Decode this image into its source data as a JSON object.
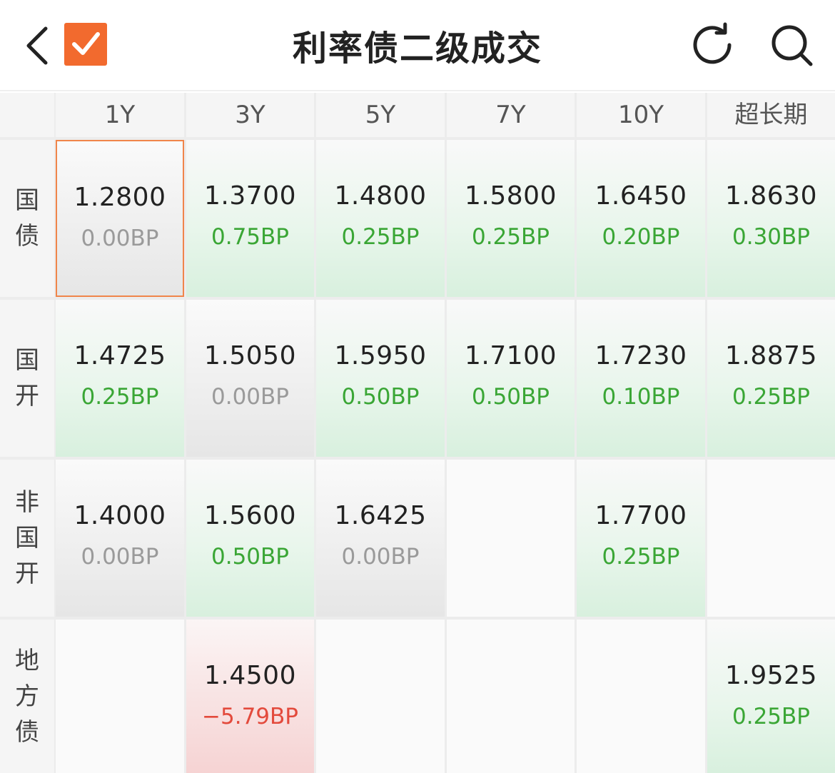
{
  "header": {
    "title": "利率债二级成交",
    "icons": {
      "back": "back-chevron-icon",
      "logo": "checkbox-logo-icon",
      "refresh": "refresh-icon",
      "search": "search-icon"
    },
    "accent_color": "#f26a2e"
  },
  "table": {
    "columns": [
      "1Y",
      "3Y",
      "5Y",
      "7Y",
      "10Y",
      "超长期"
    ],
    "rows": [
      {
        "label": [
          "国",
          "债"
        ],
        "cells": [
          {
            "value": "1.2800",
            "change": "0.00BP",
            "trend": "neutral",
            "selected": true
          },
          {
            "value": "1.3700",
            "change": "0.75BP",
            "trend": "up"
          },
          {
            "value": "1.4800",
            "change": "0.25BP",
            "trend": "up"
          },
          {
            "value": "1.5800",
            "change": "0.25BP",
            "trend": "up"
          },
          {
            "value": "1.6450",
            "change": "0.20BP",
            "trend": "up"
          },
          {
            "value": "1.8630",
            "change": "0.30BP",
            "trend": "up"
          }
        ]
      },
      {
        "label": [
          "国",
          "开"
        ],
        "cells": [
          {
            "value": "1.4725",
            "change": "0.25BP",
            "trend": "up"
          },
          {
            "value": "1.5050",
            "change": "0.00BP",
            "trend": "neutral"
          },
          {
            "value": "1.5950",
            "change": "0.50BP",
            "trend": "up"
          },
          {
            "value": "1.7100",
            "change": "0.50BP",
            "trend": "up"
          },
          {
            "value": "1.7230",
            "change": "0.10BP",
            "trend": "up"
          },
          {
            "value": "1.8875",
            "change": "0.25BP",
            "trend": "up"
          }
        ]
      },
      {
        "label": [
          "非",
          "国",
          "开"
        ],
        "cells": [
          {
            "value": "1.4000",
            "change": "0.00BP",
            "trend": "neutral"
          },
          {
            "value": "1.5600",
            "change": "0.50BP",
            "trend": "up"
          },
          {
            "value": "1.6425",
            "change": "0.00BP",
            "trend": "neutral"
          },
          {
            "value": "",
            "change": "",
            "trend": "empty"
          },
          {
            "value": "1.7700",
            "change": "0.25BP",
            "trend": "up"
          },
          {
            "value": "",
            "change": "",
            "trend": "empty"
          }
        ]
      },
      {
        "label": [
          "地",
          "方",
          "债"
        ],
        "cells": [
          {
            "value": "",
            "change": "",
            "trend": "empty"
          },
          {
            "value": "1.4500",
            "change": "−5.79BP",
            "trend": "down"
          },
          {
            "value": "",
            "change": "",
            "trend": "empty"
          },
          {
            "value": "",
            "change": "",
            "trend": "empty"
          },
          {
            "value": "",
            "change": "",
            "trend": "empty"
          },
          {
            "value": "1.9525",
            "change": "0.25BP",
            "trend": "up"
          }
        ]
      }
    ]
  },
  "colors": {
    "up": "#3aa635",
    "neutral": "#9a9a9a",
    "down": "#e34a3c",
    "selected_border": "#f0854a"
  }
}
